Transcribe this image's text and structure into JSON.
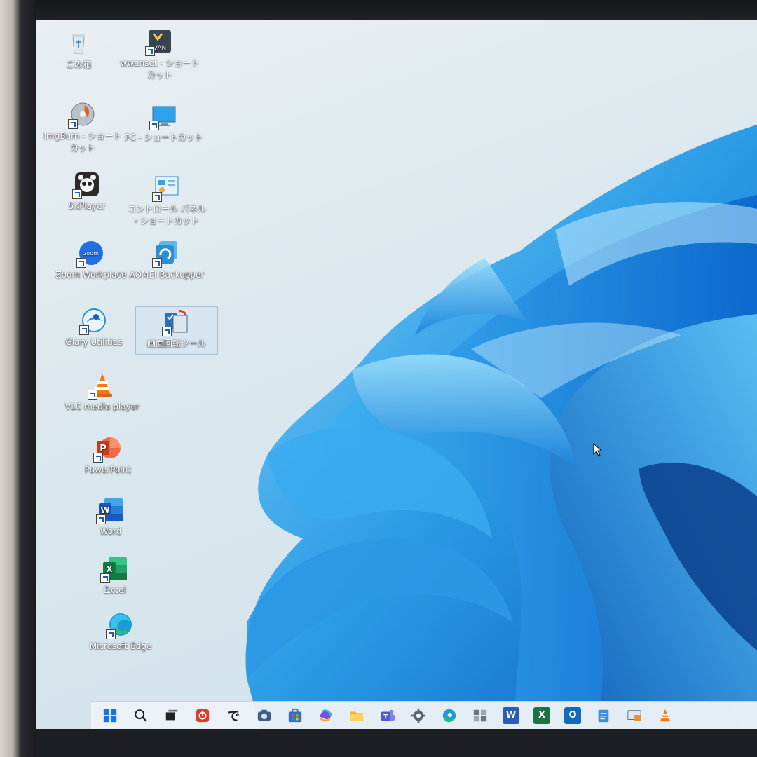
{
  "desktop": {
    "icons": [
      {
        "label": "ごみ箱",
        "icon": "recycle-bin-icon",
        "shortcut": false
      },
      {
        "label": "wwanset - ショートカット",
        "icon": "wwanset-icon",
        "shortcut": true
      },
      {
        "label": "ImgBurn - ショートカット",
        "icon": "imgburn-icon",
        "shortcut": true
      },
      {
        "label": "PC - ショートカット",
        "icon": "pc-monitor-icon",
        "shortcut": true
      },
      {
        "label": "5KPlayer",
        "icon": "5kplayer-icon",
        "shortcut": true
      },
      {
        "label": "コントロール パネル - ショートカット",
        "icon": "control-panel-icon",
        "shortcut": true
      },
      {
        "label": "Zoom Workplace",
        "icon": "zoom-icon",
        "shortcut": true
      },
      {
        "label": "AOMEI Backupper",
        "icon": "aomei-backupper-icon",
        "shortcut": true
      },
      {
        "label": "Glary Utilities",
        "icon": "glary-utilities-icon",
        "shortcut": true
      },
      {
        "label": "画面回転ツール",
        "icon": "screen-rotation-tool-icon",
        "shortcut": true,
        "selected": true
      },
      {
        "label": "VLC media player",
        "icon": "vlc-icon",
        "shortcut": true
      },
      {
        "label": "PowerPoint",
        "icon": "powerpoint-icon",
        "shortcut": true
      },
      {
        "label": "Word",
        "icon": "word-icon",
        "shortcut": true
      },
      {
        "label": "Excel",
        "icon": "excel-icon",
        "shortcut": true
      },
      {
        "label": "Microsoft Edge",
        "icon": "edge-icon",
        "shortcut": true
      }
    ]
  },
  "taskbar": {
    "items": [
      {
        "icon": "windows-start-icon",
        "color": "#1a73d9"
      },
      {
        "icon": "search-icon",
        "color": "#222222"
      },
      {
        "icon": "task-view-icon",
        "color": "#222222"
      },
      {
        "icon": "power-app-icon",
        "color": "#e0392f"
      },
      {
        "icon": "de-app-icon",
        "glyph": "で",
        "color": "#222222"
      },
      {
        "icon": "camera-icon",
        "color": "#3a5f86"
      },
      {
        "icon": "microsoft-store-icon",
        "color": "#2a6fd1"
      },
      {
        "icon": "copilot-icon",
        "color": "#7c4fd6"
      },
      {
        "icon": "file-explorer-icon",
        "color": "#f2b632"
      },
      {
        "icon": "teams-icon",
        "color": "#5059c9"
      },
      {
        "icon": "settings-gear-icon",
        "color": "#5a6470"
      },
      {
        "icon": "edge-icon",
        "color": "#1b9ad6"
      },
      {
        "icon": "photos-gallery-icon",
        "color": "#6b7580"
      },
      {
        "icon": "word-icon",
        "glyph": "W",
        "color": "#2b5db8"
      },
      {
        "icon": "excel-icon",
        "glyph": "X",
        "color": "#1e7145"
      },
      {
        "icon": "outlook-icon",
        "glyph": "O",
        "color": "#0f6cbd"
      },
      {
        "icon": "notepad-icon",
        "color": "#3a8fd6"
      },
      {
        "icon": "remote-desktop-icon",
        "color": "#e8912d"
      },
      {
        "icon": "vlc-icon",
        "color": "#f07a12"
      }
    ]
  },
  "colors": {
    "wallpaper_bloom": "#1f8fe0",
    "wallpaper_light": "#e4edf1"
  }
}
